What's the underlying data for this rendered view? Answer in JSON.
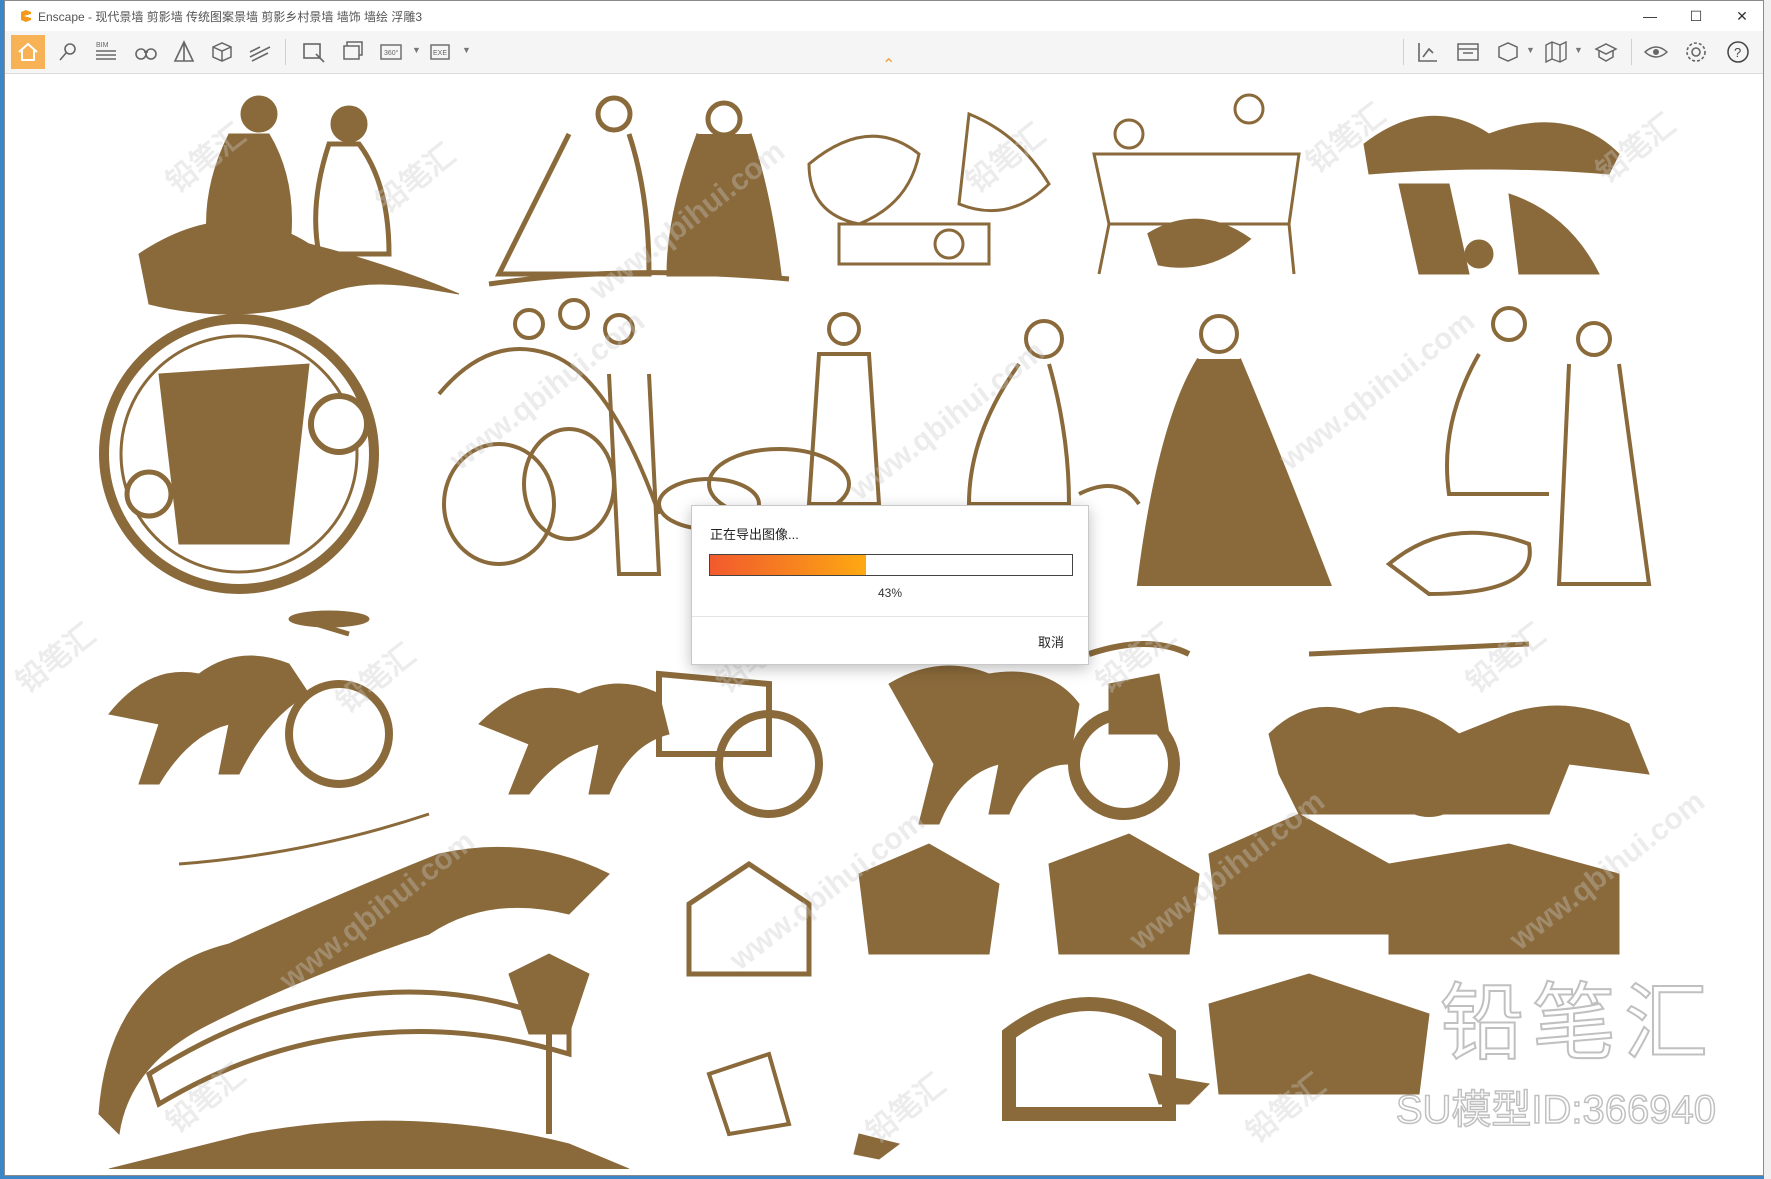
{
  "window": {
    "title": "Enscape - 现代景墙 剪影墙 传统图案景墙 剪影乡村景墙 墙饰 墙绘 浮雕3",
    "controls": {
      "minimize": "—",
      "maximize": "☐",
      "close": "✕"
    }
  },
  "toolbar": {
    "left_icons": [
      "home-icon",
      "pin-icon",
      "bim-icon",
      "binoculars-icon",
      "perspective-icon",
      "view-management-icon",
      "sections-icon",
      "screenshot-icon",
      "batch-render-icon",
      "panorama-icon",
      "export-icon"
    ],
    "right_icons": [
      "material-editor-icon",
      "asset-library-icon",
      "visual-settings-icon",
      "map-icon",
      "upload-icon",
      "view-icon",
      "settings-icon",
      "help-icon"
    ],
    "bim_label": "BIM",
    "panorama_label": "360°",
    "export_label": "EXE"
  },
  "dialog": {
    "title": "正在导出图像...",
    "progress_fraction": 0.43,
    "progress_text": "43%",
    "cancel_label": "取消"
  },
  "overlay": {
    "brand": "铅笔汇",
    "model_id": "SU模型ID:366940",
    "watermark_cn": "铅笔汇",
    "watermark_url": "www.qbihui.com"
  },
  "colors": {
    "art_brown": "#8a6a3b",
    "accent_orange": "#f7a13a",
    "progress_start": "#f25a2e",
    "progress_end": "#ffa912"
  }
}
